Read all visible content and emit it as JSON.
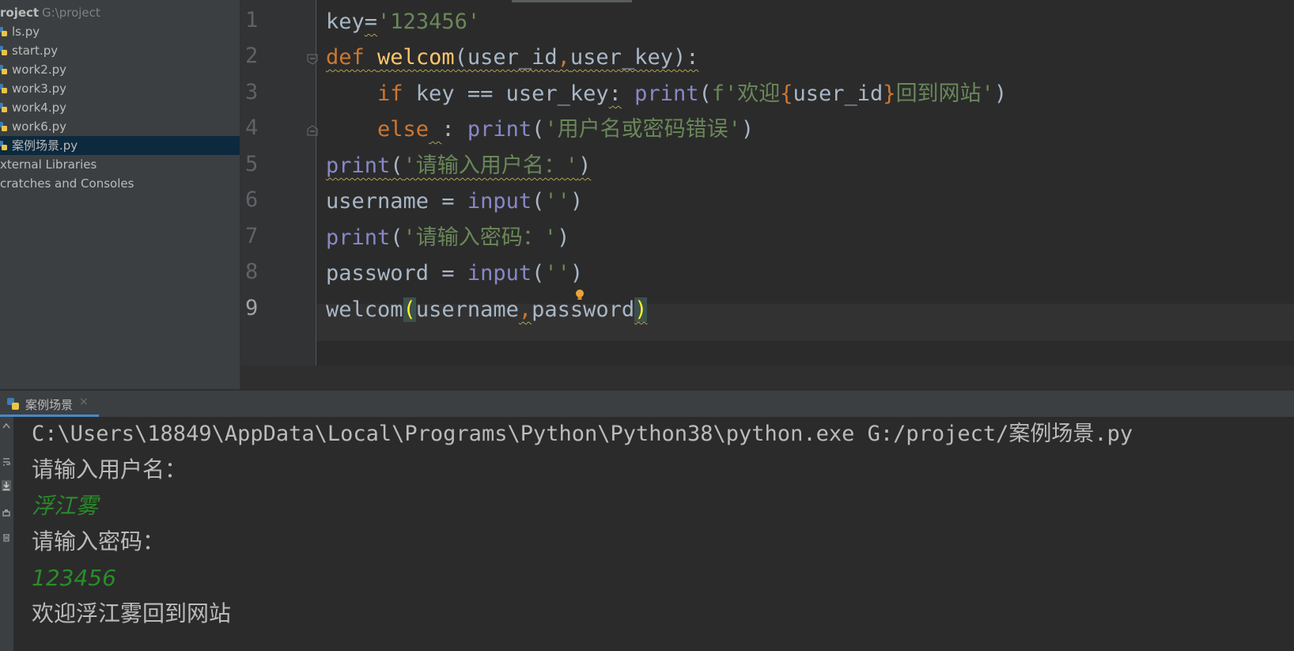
{
  "project": {
    "root_name": "roject",
    "root_path": "G:\\project",
    "files": [
      {
        "name": "ls.py",
        "selected": false
      },
      {
        "name": "start.py",
        "selected": false
      },
      {
        "name": "work2.py",
        "selected": false
      },
      {
        "name": "work3.py",
        "selected": false
      },
      {
        "name": "work4.py",
        "selected": false
      },
      {
        "name": "work6.py",
        "selected": false
      },
      {
        "name": "案例场景.py",
        "selected": true
      }
    ],
    "external_libraries": "xternal Libraries",
    "scratches": "cratches and Consoles"
  },
  "editor": {
    "line_numbers": [
      "1",
      "2",
      "3",
      "4",
      "5",
      "6",
      "7",
      "8",
      "9"
    ],
    "current_line": "9",
    "lines": {
      "l1": {
        "a": "key",
        "b": "=",
        "c": "'123456'"
      },
      "l2": {
        "a": "def",
        "b": " ",
        "c": "welcom",
        "d": "(user_id",
        "e": ",",
        "f": "user_key):"
      },
      "l3": {
        "a": "    ",
        "b": "if",
        "c": " key == user_key",
        "d": ":",
        "e": " ",
        "f": "print",
        "g": "(",
        "h": "f'欢迎",
        "i": "{",
        "j": "user_id",
        "k": "}",
        "l": "回到网站'",
        "m": ")"
      },
      "l4": {
        "a": "    ",
        "b": "else",
        "c": " ",
        "d": ":",
        "e": " ",
        "f": "print",
        "g": "(",
        "h": "'用户名或密码错误'",
        "i": ")"
      },
      "l5": {
        "a": "print",
        "b": "(",
        "c": "'请输入用户名：'",
        "d": ")"
      },
      "l6": {
        "a": "username = ",
        "b": "input",
        "c": "(",
        "d": "''",
        "e": ")"
      },
      "l7": {
        "a": "print",
        "b": "(",
        "c": "'请输入密码：'",
        "d": ")"
      },
      "l8": {
        "a": "password = ",
        "b": "input",
        "c": "(",
        "d": "''",
        "e": ")"
      },
      "l9": {
        "a": "welcom",
        "b": "(",
        "c": "username",
        "d": ",",
        "e": "password",
        "f": ")"
      }
    }
  },
  "run": {
    "tab_label": "案例场景",
    "tab_close": "×",
    "console": [
      "C:\\Users\\18849\\AppData\\Local\\Programs\\Python\\Python38\\python.exe G:/project/案例场景.py",
      "请输入用户名：",
      "浮江雾",
      "请输入密码：",
      "123456",
      "欢迎浮江雾回到网站"
    ]
  },
  "colors": {
    "background": "#2b2b2b",
    "panel": "#3c3f41",
    "selection": "#0d293e",
    "keyword": "#cc7832",
    "function": "#ffc66d",
    "builtin": "#8888c6",
    "string": "#6a8759",
    "user_input": "#2a8c2a"
  },
  "icons": {
    "file": "python-file-icon",
    "fold": "fold-marker-icon",
    "intention": "lightbulb-icon"
  }
}
